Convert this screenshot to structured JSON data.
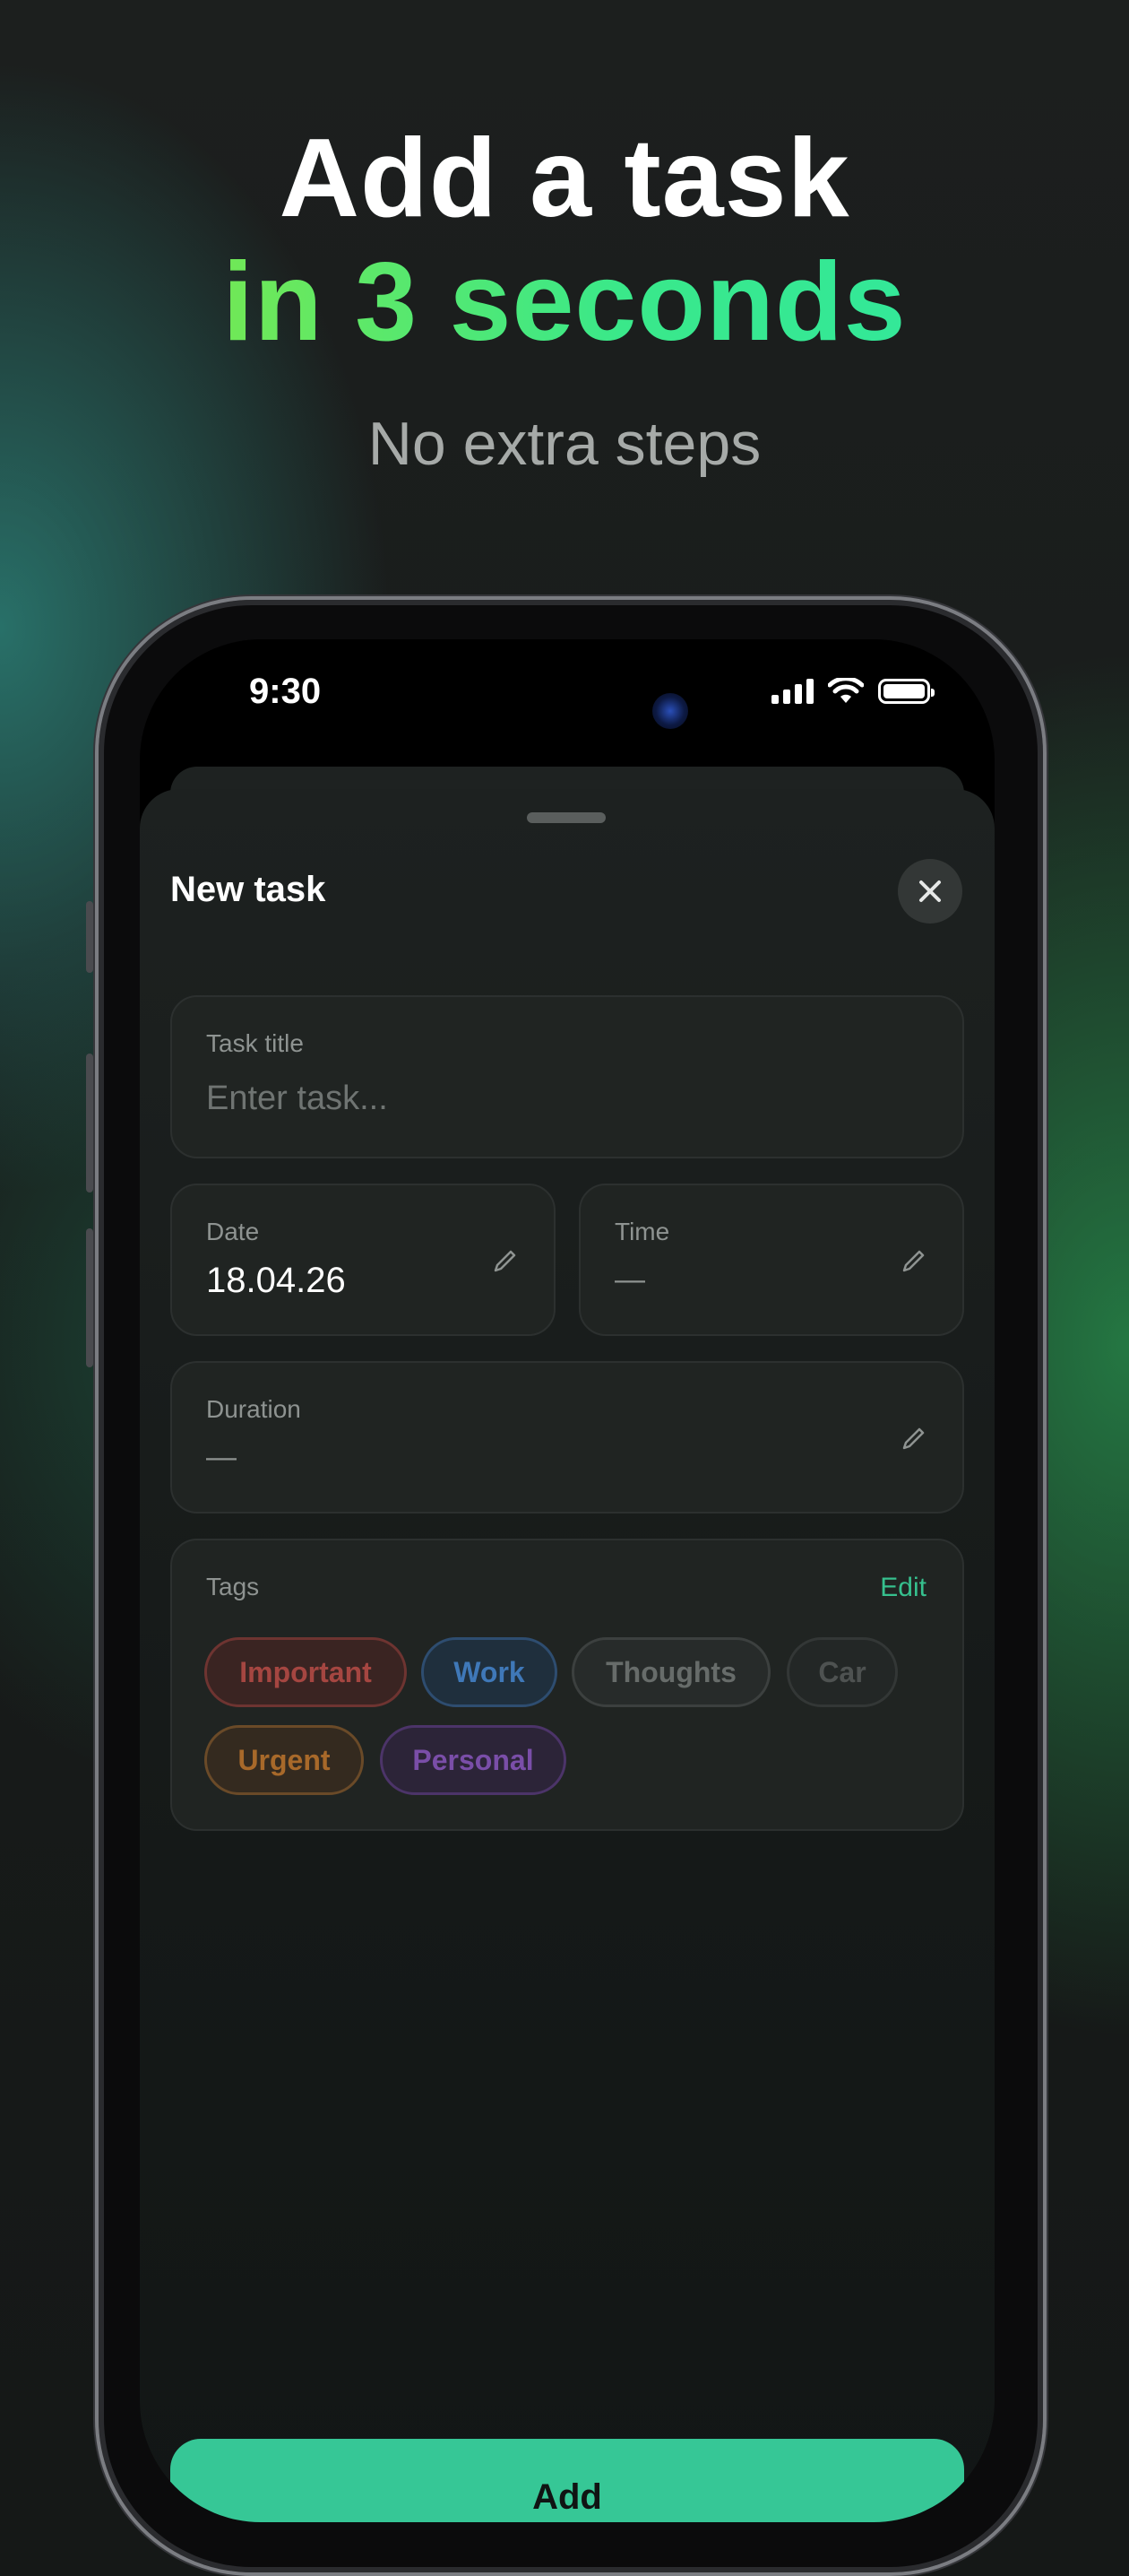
{
  "headline": {
    "line1": "Add a task",
    "line2": "in 3 seconds",
    "subtitle": "No extra steps"
  },
  "status_bar": {
    "time": "9:30",
    "icons": [
      "signal-icon",
      "wifi-icon",
      "battery-icon"
    ]
  },
  "sheet": {
    "title": "New task",
    "close_icon": "close-icon",
    "task_title": {
      "label": "Task title",
      "placeholder": "Enter task..."
    },
    "date": {
      "label": "Date",
      "value": "18.04.26",
      "icon": "pencil-icon"
    },
    "time": {
      "label": "Time",
      "value": "—",
      "icon": "pencil-icon"
    },
    "duration": {
      "label": "Duration",
      "value": "—",
      "icon": "pencil-icon"
    },
    "tags": {
      "label": "Tags",
      "edit_label": "Edit",
      "items": [
        {
          "label": "Important",
          "color": "#c14a44"
        },
        {
          "label": "Work",
          "color": "#3f78b8"
        },
        {
          "label": "Thoughts",
          "color": "#6e7371"
        },
        {
          "label": "Car",
          "color": "#5a5e5d"
        },
        {
          "label": "Urgent",
          "color": "#b9772e"
        },
        {
          "label": "Personal",
          "color": "#7f4fb0"
        }
      ]
    },
    "add_button": "Add"
  },
  "colors": {
    "accent": "#36c796",
    "headline_green": "#3ae88a",
    "headline_lime": "#8fe83a"
  }
}
